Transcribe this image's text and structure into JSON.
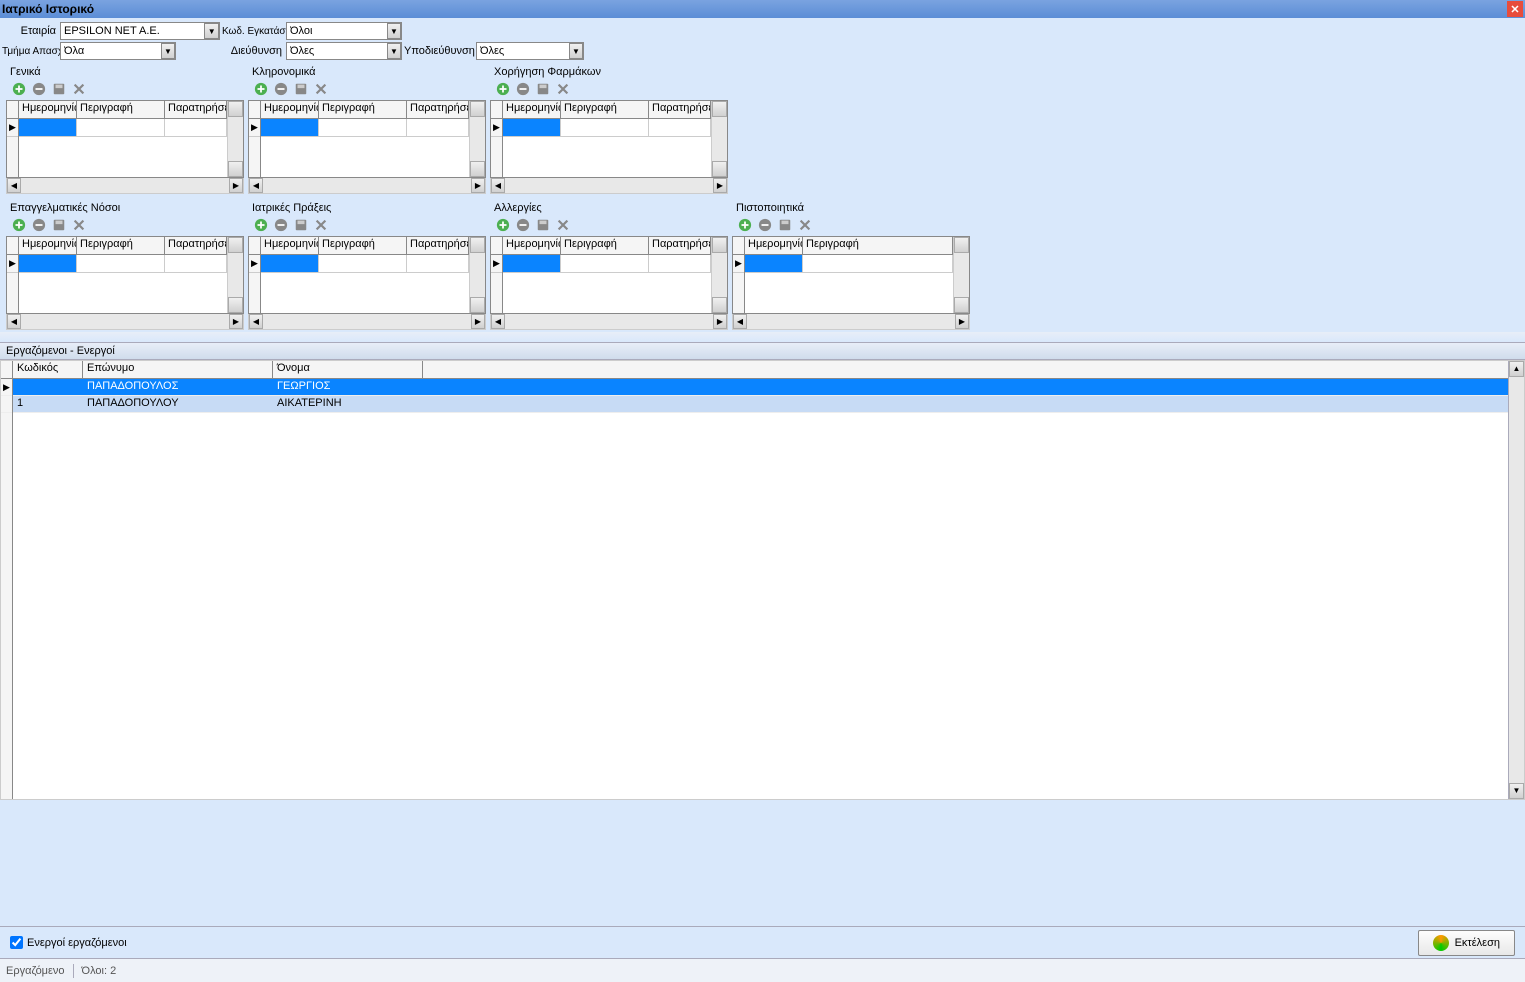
{
  "window": {
    "title": "Ιατρικό Ιστορικό"
  },
  "filters": {
    "company_label": "Εταιρία",
    "company_value": "EPSILON NET A.E.",
    "install_label": "Κωδ. Εγκατάστασης",
    "install_value": "Όλοι",
    "dept_label": "Τμήμα Απασχόλησης",
    "dept_value": "Όλα",
    "dir_label": "Διεύθυνση",
    "dir_value": "Όλες",
    "subdir_label": "Υποδιεύθυνση",
    "subdir_value": "Όλες"
  },
  "panel_columns": {
    "date": "Ημερομηνία",
    "desc": "Περιγραφή",
    "remark": "Παρατηρήσε"
  },
  "panels": [
    {
      "title": "Γενικά",
      "cols": [
        "date",
        "desc",
        "remark"
      ]
    },
    {
      "title": "Κληρονομικά",
      "cols": [
        "date",
        "desc",
        "remark"
      ]
    },
    {
      "title": "Χορήγηση Φαρμάκων",
      "cols": [
        "date",
        "desc",
        "remark"
      ]
    },
    {
      "title": "Επαγγελματικές Νόσοι",
      "cols": [
        "date",
        "desc",
        "remark"
      ]
    },
    {
      "title": "Ιατρικές Πράξεις",
      "cols": [
        "date",
        "desc",
        "remark"
      ]
    },
    {
      "title": "Αλλεργίες",
      "cols": [
        "date",
        "desc",
        "remark"
      ]
    },
    {
      "title": "Πιστοποιητικά",
      "cols": [
        "date",
        "desc"
      ]
    }
  ],
  "employees": {
    "section_title": "Εργαζόμενοι - Ενεργοί",
    "headers": {
      "code": "Κωδικός",
      "surname": "Επώνυμο",
      "name": "Όνομα"
    },
    "rows": [
      {
        "code": "",
        "surname": "ΠΑΠΑΔΟΠΟΥΛΟΣ",
        "name": "ΓΕΩΡΓΙΟΣ",
        "selected": true
      },
      {
        "code": "1",
        "surname": "ΠΑΠΑΔΟΠΟΥΛΟΥ",
        "name": "ΑΙΚΑΤΕΡΙΝΗ",
        "selected": false
      }
    ]
  },
  "footer": {
    "active_label": "Ενεργοί εργαζόμενοι",
    "exec_label": "Εκτέλεση"
  },
  "status": {
    "left": "Εργαζόμενο",
    "count": "Όλοι: 2"
  }
}
